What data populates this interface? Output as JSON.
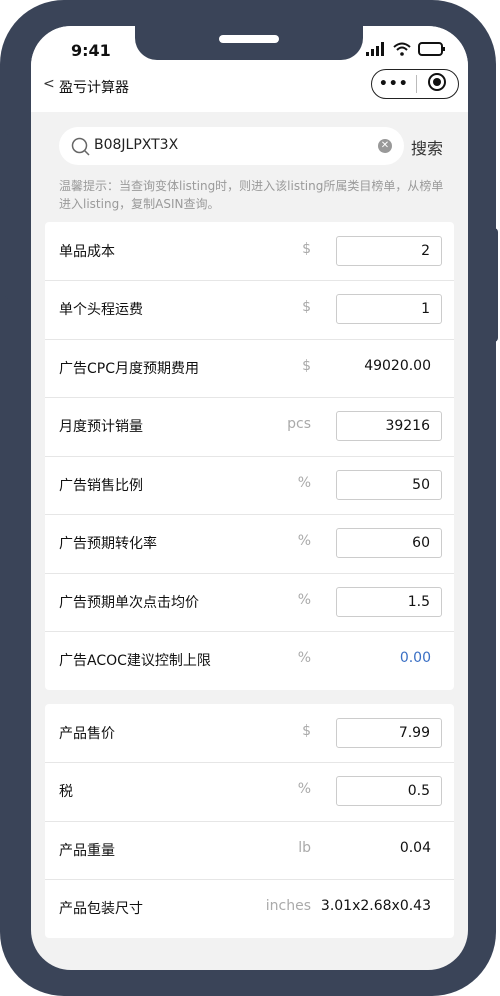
{
  "status_bar": {
    "time": "9:41"
  },
  "nav": {
    "back_glyph": "<",
    "title": "盈亏计算器",
    "menu_glyph": "•••"
  },
  "search": {
    "value": "B08JLPXT3X",
    "button_label": "搜索"
  },
  "hint": "温馨提示：当查询变体listing时，则进入该listing所属类目榜单，从榜单进入listing，复制ASIN查询。",
  "section1": [
    {
      "label": "单品成本",
      "unit": "$",
      "value": "2",
      "editable": true
    },
    {
      "label": "单个头程运费",
      "unit": "$",
      "value": "1",
      "editable": true
    },
    {
      "label": "广告CPC月度预期费用",
      "unit": "$",
      "value": "49020.00",
      "editable": false
    },
    {
      "label": "月度预计销量",
      "unit": "pcs",
      "value": "39216",
      "editable": true
    },
    {
      "label": "广告销售比例",
      "unit": "%",
      "value": "50",
      "editable": true
    },
    {
      "label": "广告预期转化率",
      "unit": "%",
      "value": "60",
      "editable": true
    },
    {
      "label": "广告预期单次点击均价",
      "unit": "%",
      "value": "1.5",
      "editable": true
    },
    {
      "label": "广告ACOC建议控制上限",
      "unit": "%",
      "value": "0.00",
      "editable": false
    }
  ],
  "section2": [
    {
      "label": "产品售价",
      "unit": "$",
      "value": "7.99",
      "editable": true
    },
    {
      "label": "税",
      "unit": "%",
      "value": "0.5",
      "editable": true
    },
    {
      "label": "产品重量",
      "unit": "lb",
      "value": "0.04",
      "editable": false
    },
    {
      "label": "产品包装尺寸",
      "unit": "inches",
      "value": "3.01x2.68x0.43",
      "editable": false
    }
  ],
  "colors": {
    "frame": "#3a4458",
    "background": "#f2f2f2",
    "accent_blue": "#3a6fc4"
  },
  "icons": [
    "signal-icon",
    "wifi-icon",
    "battery-icon",
    "search-icon",
    "clear-icon",
    "target-icon"
  ]
}
